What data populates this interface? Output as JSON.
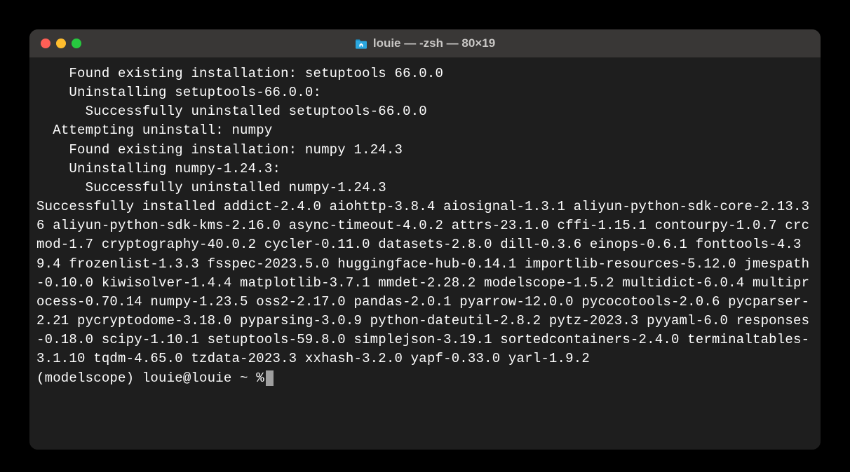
{
  "titlebar": {
    "title": "louie — -zsh — 80×19",
    "folder_icon_name": "home-folder-icon"
  },
  "terminal": {
    "output": "    Found existing installation: setuptools 66.0.0\n    Uninstalling setuptools-66.0.0:\n      Successfully uninstalled setuptools-66.0.0\n  Attempting uninstall: numpy\n    Found existing installation: numpy 1.24.3\n    Uninstalling numpy-1.24.3:\n      Successfully uninstalled numpy-1.24.3\nSuccessfully installed addict-2.4.0 aiohttp-3.8.4 aiosignal-1.3.1 aliyun-python-sdk-core-2.13.36 aliyun-python-sdk-kms-2.16.0 async-timeout-4.0.2 attrs-23.1.0 cffi-1.15.1 contourpy-1.0.7 crcmod-1.7 cryptography-40.0.2 cycler-0.11.0 datasets-2.8.0 dill-0.3.6 einops-0.6.1 fonttools-4.39.4 frozenlist-1.3.3 fsspec-2023.5.0 huggingface-hub-0.14.1 importlib-resources-5.12.0 jmespath-0.10.0 kiwisolver-1.4.4 matplotlib-3.7.1 mmdet-2.28.2 modelscope-1.5.2 multidict-6.0.4 multiprocess-0.70.14 numpy-1.23.5 oss2-2.17.0 pandas-2.0.1 pyarrow-12.0.0 pycocotools-2.0.6 pycparser-2.21 pycryptodome-3.18.0 pyparsing-3.0.9 python-dateutil-2.8.2 pytz-2023.3 pyyaml-6.0 responses-0.18.0 scipy-1.10.1 setuptools-59.8.0 simplejson-3.19.1 sortedcontainers-2.4.0 terminaltables-3.1.10 tqdm-4.65.0 tzdata-2023.3 xxhash-3.2.0 yapf-0.33.0 yarl-1.9.2",
    "prompt": "(modelscope) louie@louie ~ % "
  },
  "colors": {
    "bg": "#000000",
    "window_bg": "#1e1e1e",
    "titlebar_bg": "#393736",
    "text": "#fdfdfd",
    "folder_icon": "#2ba7df"
  }
}
